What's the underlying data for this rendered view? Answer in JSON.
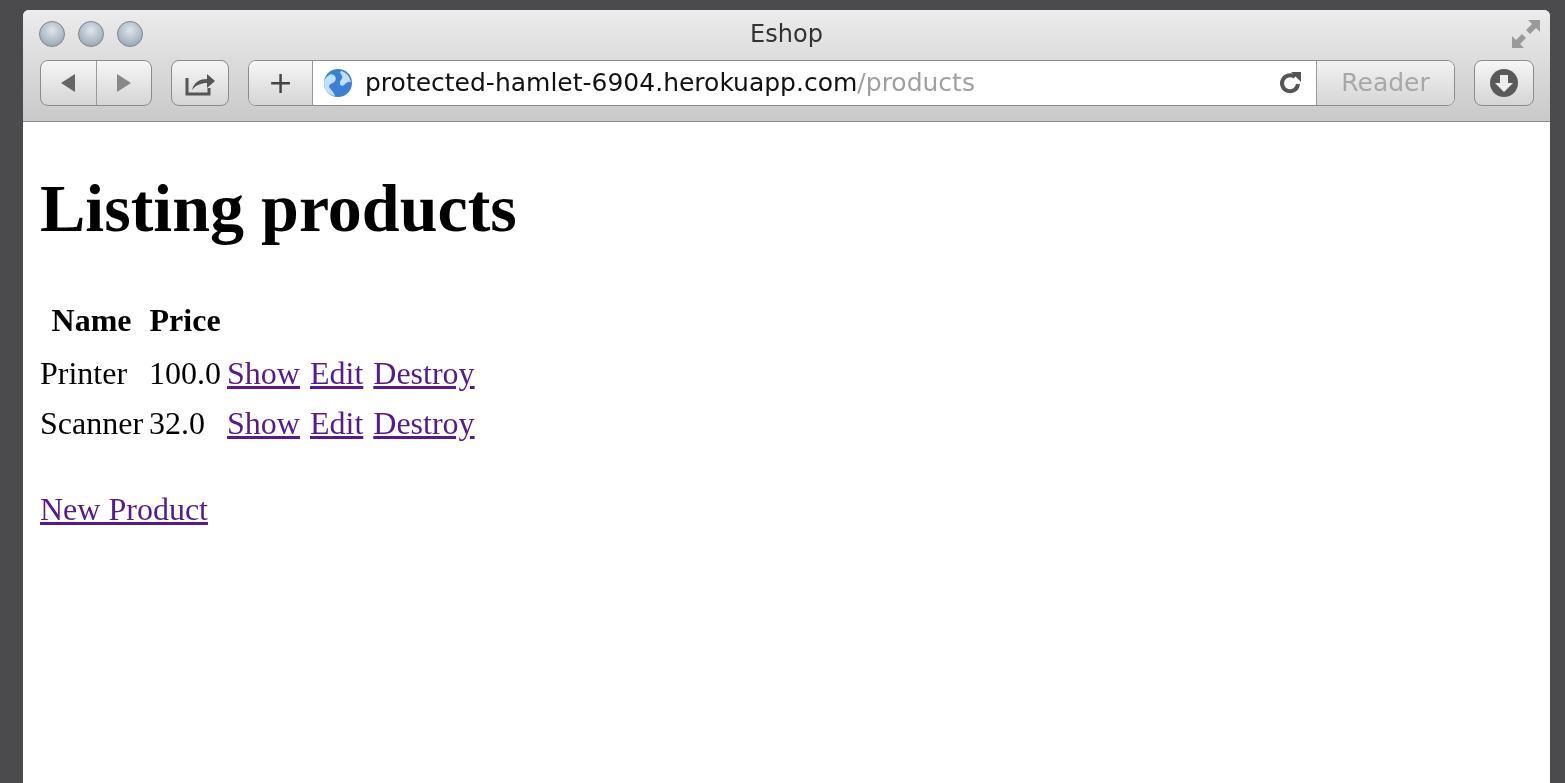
{
  "window": {
    "title": "Eshop"
  },
  "toolbar": {
    "url": {
      "host": "protected-hamlet-6904.herokuapp.com",
      "path": "/products"
    },
    "reader": {
      "label": "Reader",
      "disabled": true
    },
    "new_tab": {
      "label": "+"
    }
  },
  "page": {
    "heading": "Listing products",
    "table": {
      "columns": [
        "Name",
        "Price"
      ],
      "rows": [
        {
          "name": "Printer",
          "price": "100.0",
          "actions": [
            "Show",
            "Edit",
            "Destroy"
          ]
        },
        {
          "name": "Scanner",
          "price": "32.0",
          "actions": [
            "Show",
            "Edit",
            "Destroy"
          ]
        }
      ]
    },
    "new_link": "New Product"
  }
}
